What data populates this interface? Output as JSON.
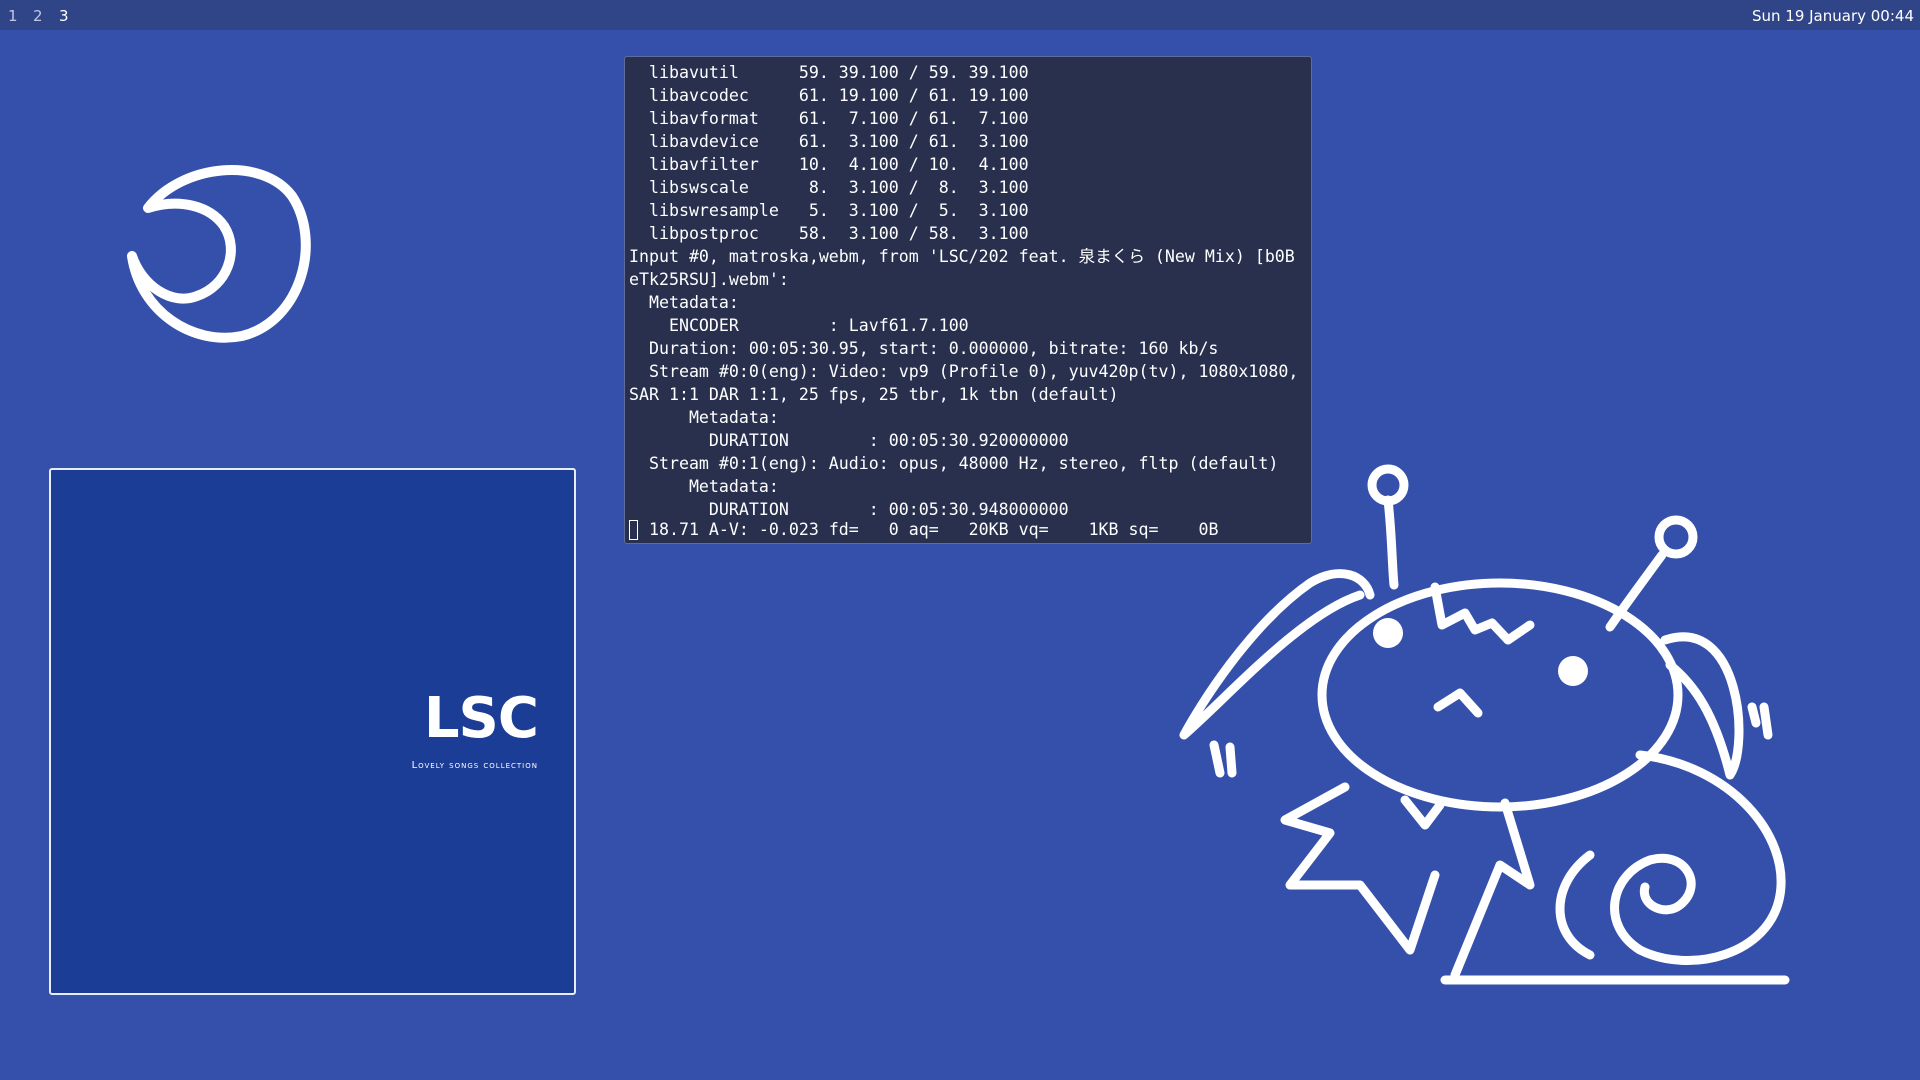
{
  "topbar": {
    "workspaces": [
      {
        "label": "1",
        "active": false
      },
      {
        "label": "2",
        "active": false
      },
      {
        "label": "3",
        "active": true
      }
    ],
    "clock": "Sun 19 January 00:44"
  },
  "terminal": {
    "lines": [
      "  libavutil      59. 39.100 / 59. 39.100",
      "  libavcodec     61. 19.100 / 61. 19.100",
      "  libavformat    61.  7.100 / 61.  7.100",
      "  libavdevice    61.  3.100 / 61.  3.100",
      "  libavfilter    10.  4.100 / 10.  4.100",
      "  libswscale      8.  3.100 /  8.  3.100",
      "  libswresample   5.  3.100 /  5.  3.100",
      "  libpostproc    58.  3.100 / 58.  3.100",
      "Input #0, matroska,webm, from 'LSC/202 feat. 泉まくら (New Mix) [b0B",
      "eTk25RSU].webm':",
      "  Metadata:",
      "    ENCODER         : Lavf61.7.100",
      "  Duration: 00:05:30.95, start: 0.000000, bitrate: 160 kb/s",
      "  Stream #0:0(eng): Video: vp9 (Profile 0), yuv420p(tv), 1080x1080,",
      "SAR 1:1 DAR 1:1, 25 fps, 25 tbr, 1k tbn (default)",
      "      Metadata:",
      "        DURATION        : 00:05:30.920000000",
      "  Stream #0:1(eng): Audio: opus, 48000 Hz, stereo, fltp (default)",
      "      Metadata:",
      "        DURATION        : 00:05:30.948000000"
    ],
    "status": " 18.71 A-V: -0.023 fd=   0 aq=   20KB vq=    1KB sq=    0B"
  },
  "album": {
    "title": "LSC",
    "subtitle": "Lovely songs collection"
  },
  "icons": {
    "moon": "crescent-moon-icon",
    "mascot": "antenna-creature-illustration"
  },
  "colors": {
    "desktop": "#3450ab",
    "bar": "#2f4587",
    "terminal_bg": "#28304e",
    "album_bg": "#1c3d95",
    "foreground": "#ffffff"
  }
}
